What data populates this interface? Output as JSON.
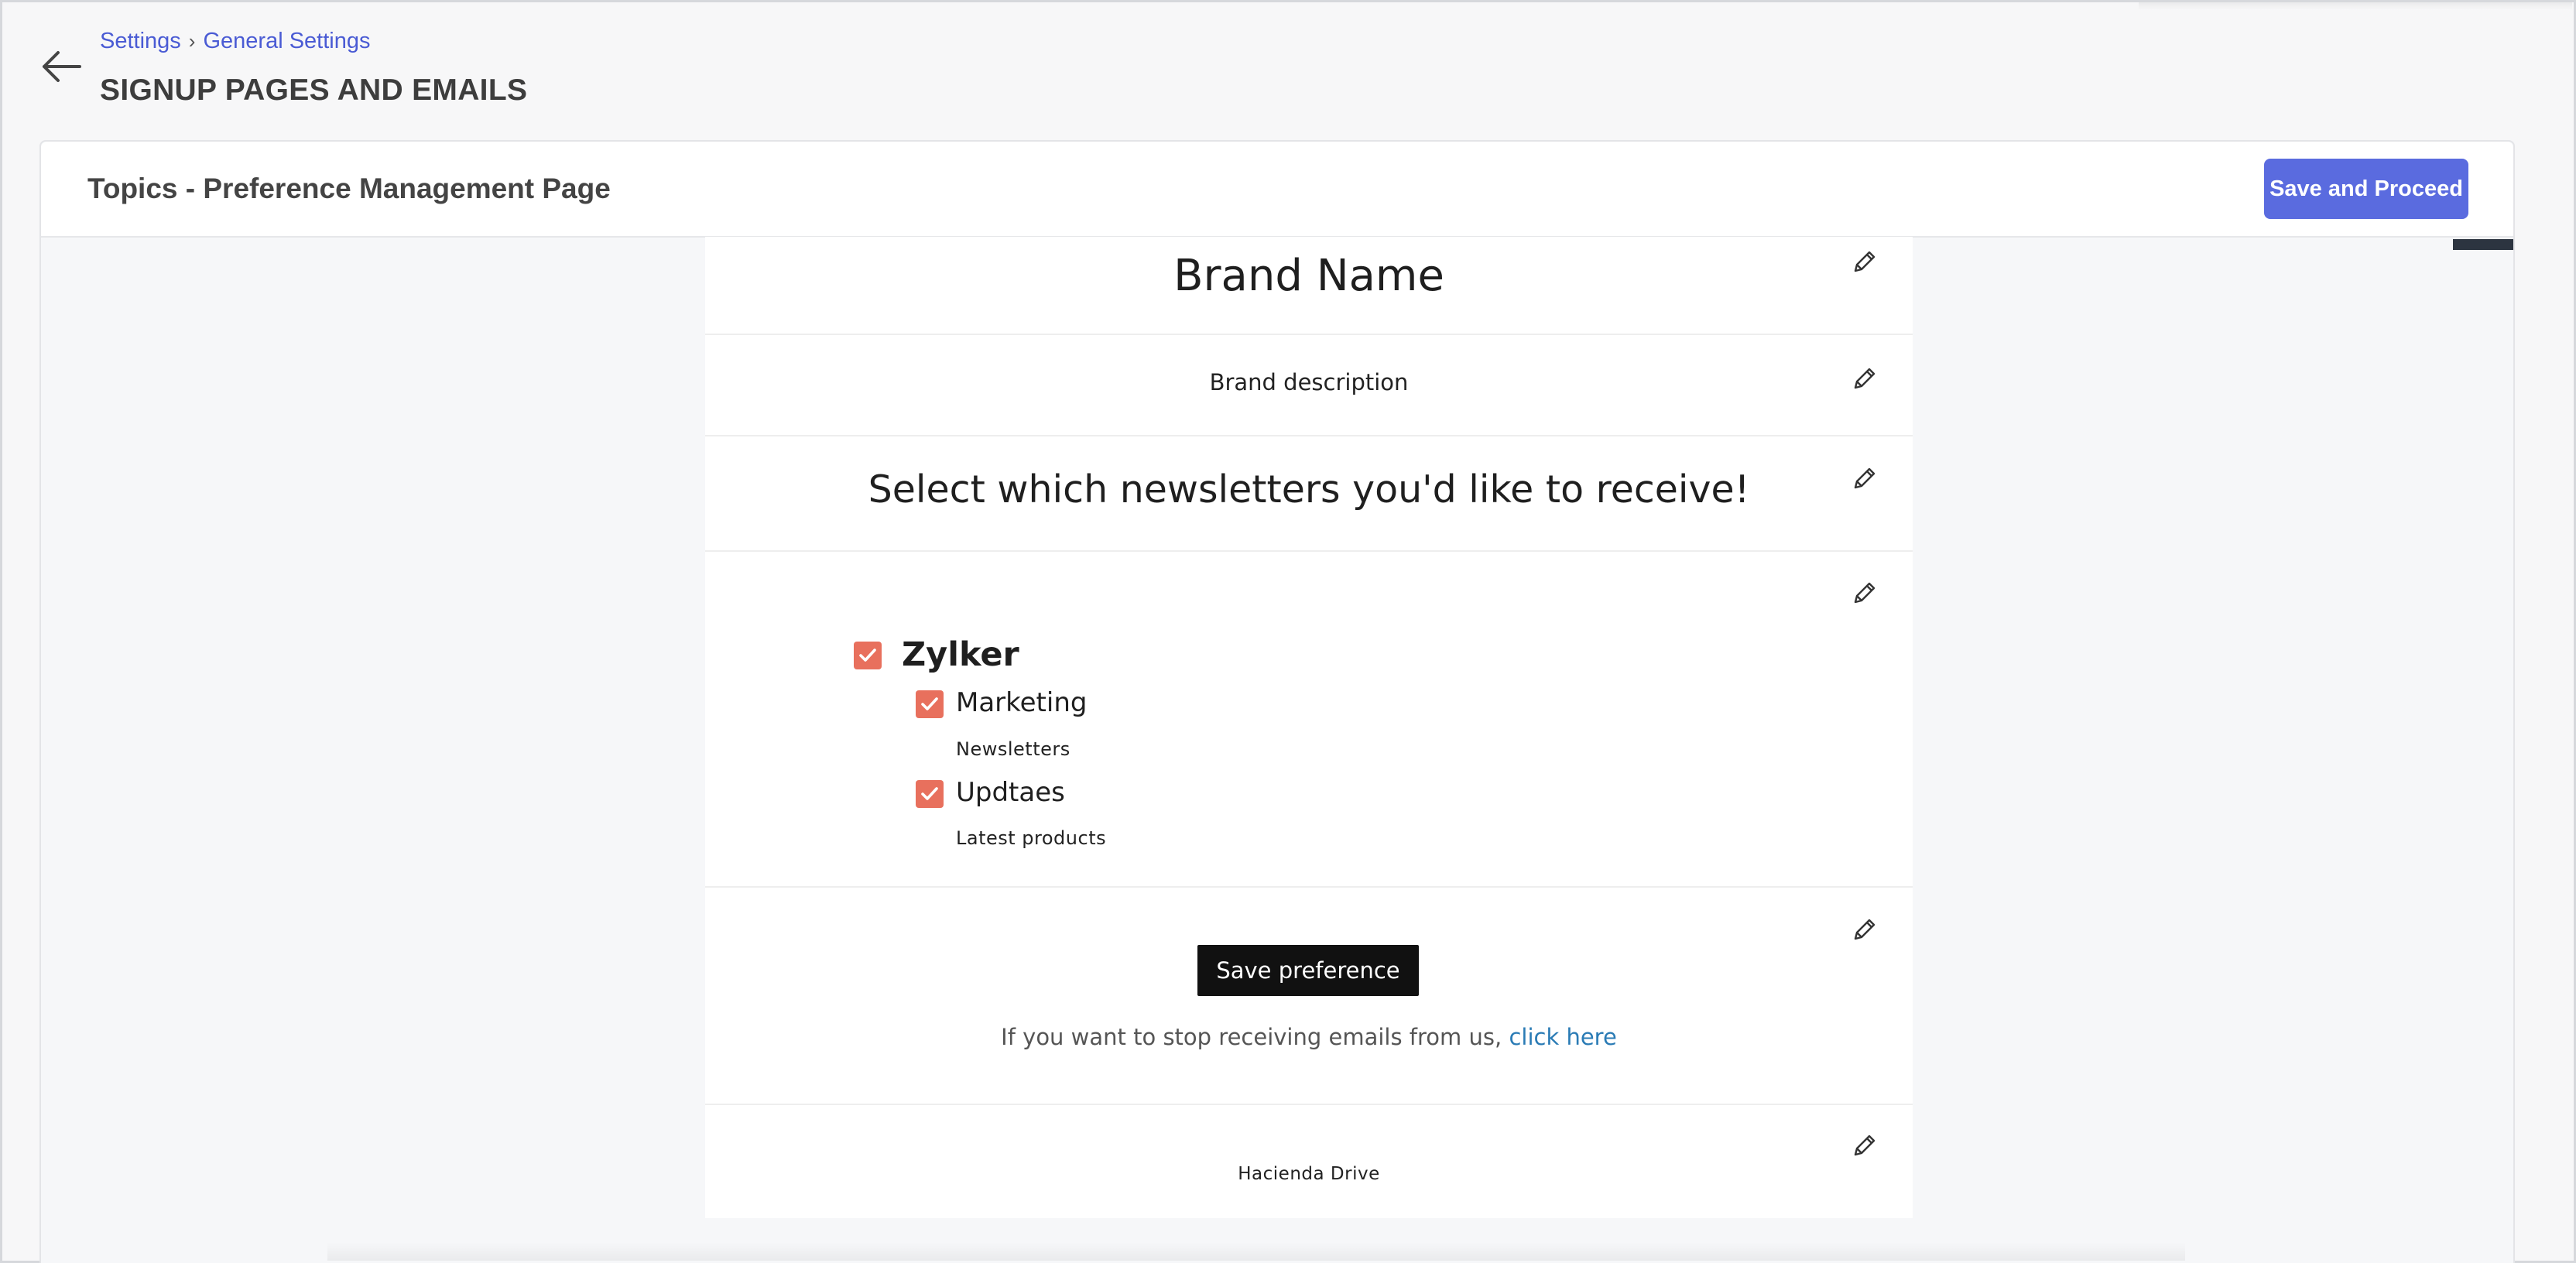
{
  "header": {
    "breadcrumb": {
      "root": "Settings",
      "separator": "›",
      "current": "General Settings"
    },
    "title": "SIGNUP PAGES AND EMAILS"
  },
  "card": {
    "title": "Topics - Preference Management Page",
    "save_label": "Save and Proceed"
  },
  "preview": {
    "brand_name": "Brand Name",
    "brand_description": "Brand description",
    "heading": "Select which newsletters you'd like to receive!",
    "topics": {
      "main": {
        "label": "Zylker",
        "checked": true
      },
      "items": [
        {
          "label": "Marketing",
          "description": "Newsletters",
          "checked": true
        },
        {
          "label": "Updtaes",
          "description": "Latest products",
          "checked": true
        }
      ]
    },
    "save_preference_label": "Save preference",
    "unsubscribe_text": "If you want to stop receiving emails from us,",
    "unsubscribe_link": "click here",
    "address": "Hacienda Drive"
  },
  "colors": {
    "accent": "#5a6bdf",
    "link": "#4a5bd4",
    "checkbox": "#e8705d",
    "unsubscribe_link": "#2a7bb5"
  }
}
